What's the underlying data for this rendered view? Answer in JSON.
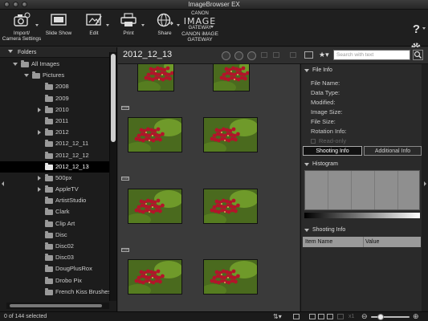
{
  "window": {
    "title": "ImageBrowser EX"
  },
  "toolbar": {
    "import_label": "Import/\nCamera Settings",
    "slideshow_label": "Slide Show",
    "edit_label": "Edit",
    "print_label": "Print",
    "share_label": "Share",
    "canon_line1": "CANON",
    "canon_line2": "IMAGE",
    "canon_line3": "GATEWAY",
    "canon_label": "CANON iMAGE\nGATEWAY"
  },
  "folders": {
    "header": "Folders",
    "items": [
      {
        "label": "All Images",
        "level": 0,
        "state": "open",
        "selected": false
      },
      {
        "label": "Pictures",
        "level": 1,
        "state": "open",
        "selected": false
      },
      {
        "label": "2008",
        "level": 2,
        "state": "none",
        "selected": false
      },
      {
        "label": "2009",
        "level": 2,
        "state": "none",
        "selected": false
      },
      {
        "label": "2010",
        "level": 2,
        "state": "closed",
        "selected": false
      },
      {
        "label": "2011",
        "level": 2,
        "state": "none",
        "selected": false
      },
      {
        "label": "2012",
        "level": 2,
        "state": "closed",
        "selected": false
      },
      {
        "label": "2012_12_11",
        "level": 2,
        "state": "none",
        "selected": false
      },
      {
        "label": "2012_12_12",
        "level": 2,
        "state": "none",
        "selected": false
      },
      {
        "label": "2012_12_13",
        "level": 2,
        "state": "none",
        "selected": true
      },
      {
        "label": "500px",
        "level": 2,
        "state": "closed",
        "selected": false
      },
      {
        "label": "AppleTV",
        "level": 2,
        "state": "closed",
        "selected": false
      },
      {
        "label": "ArtistStudio",
        "level": 2,
        "state": "none",
        "selected": false
      },
      {
        "label": "Clark",
        "level": 2,
        "state": "none",
        "selected": false
      },
      {
        "label": "Clip Art",
        "level": 2,
        "state": "none",
        "selected": false
      },
      {
        "label": "Disc",
        "level": 2,
        "state": "none",
        "selected": false
      },
      {
        "label": "Disc02",
        "level": 2,
        "state": "none",
        "selected": false
      },
      {
        "label": "Disc03",
        "level": 2,
        "state": "none",
        "selected": false
      },
      {
        "label": "DougPlusRox",
        "level": 2,
        "state": "none",
        "selected": false
      },
      {
        "label": "Drobo Pix",
        "level": 2,
        "state": "none",
        "selected": false
      },
      {
        "label": "French Kiss Brushes",
        "level": 2,
        "state": "none",
        "selected": false
      }
    ]
  },
  "browser": {
    "folder_title": "2012_12_13",
    "raw_badge": "RAW"
  },
  "search": {
    "placeholder": "Search with text"
  },
  "file_info": {
    "header": "File Info",
    "fields": [
      {
        "label": "File Name:"
      },
      {
        "label": "Data Type:"
      },
      {
        "label": "Modified:"
      },
      {
        "label": "Image Size:"
      },
      {
        "label": "File Size:"
      },
      {
        "label": "Rotation Info:"
      }
    ],
    "read_only": "Read-only"
  },
  "tabs": {
    "shooting": "Shooting Info",
    "additional": "Additional Info"
  },
  "histogram": {
    "header": "Histogram"
  },
  "shooting_info": {
    "header": "Shooting Info",
    "col_item": "Item Name",
    "col_value": "Value"
  },
  "status": {
    "count": "0 of 144 selected",
    "zoom": "x1"
  },
  "colors": {
    "selected_row": "#000000",
    "panel": "#2a2a2a",
    "grid_bg": "#3a3a3a"
  }
}
